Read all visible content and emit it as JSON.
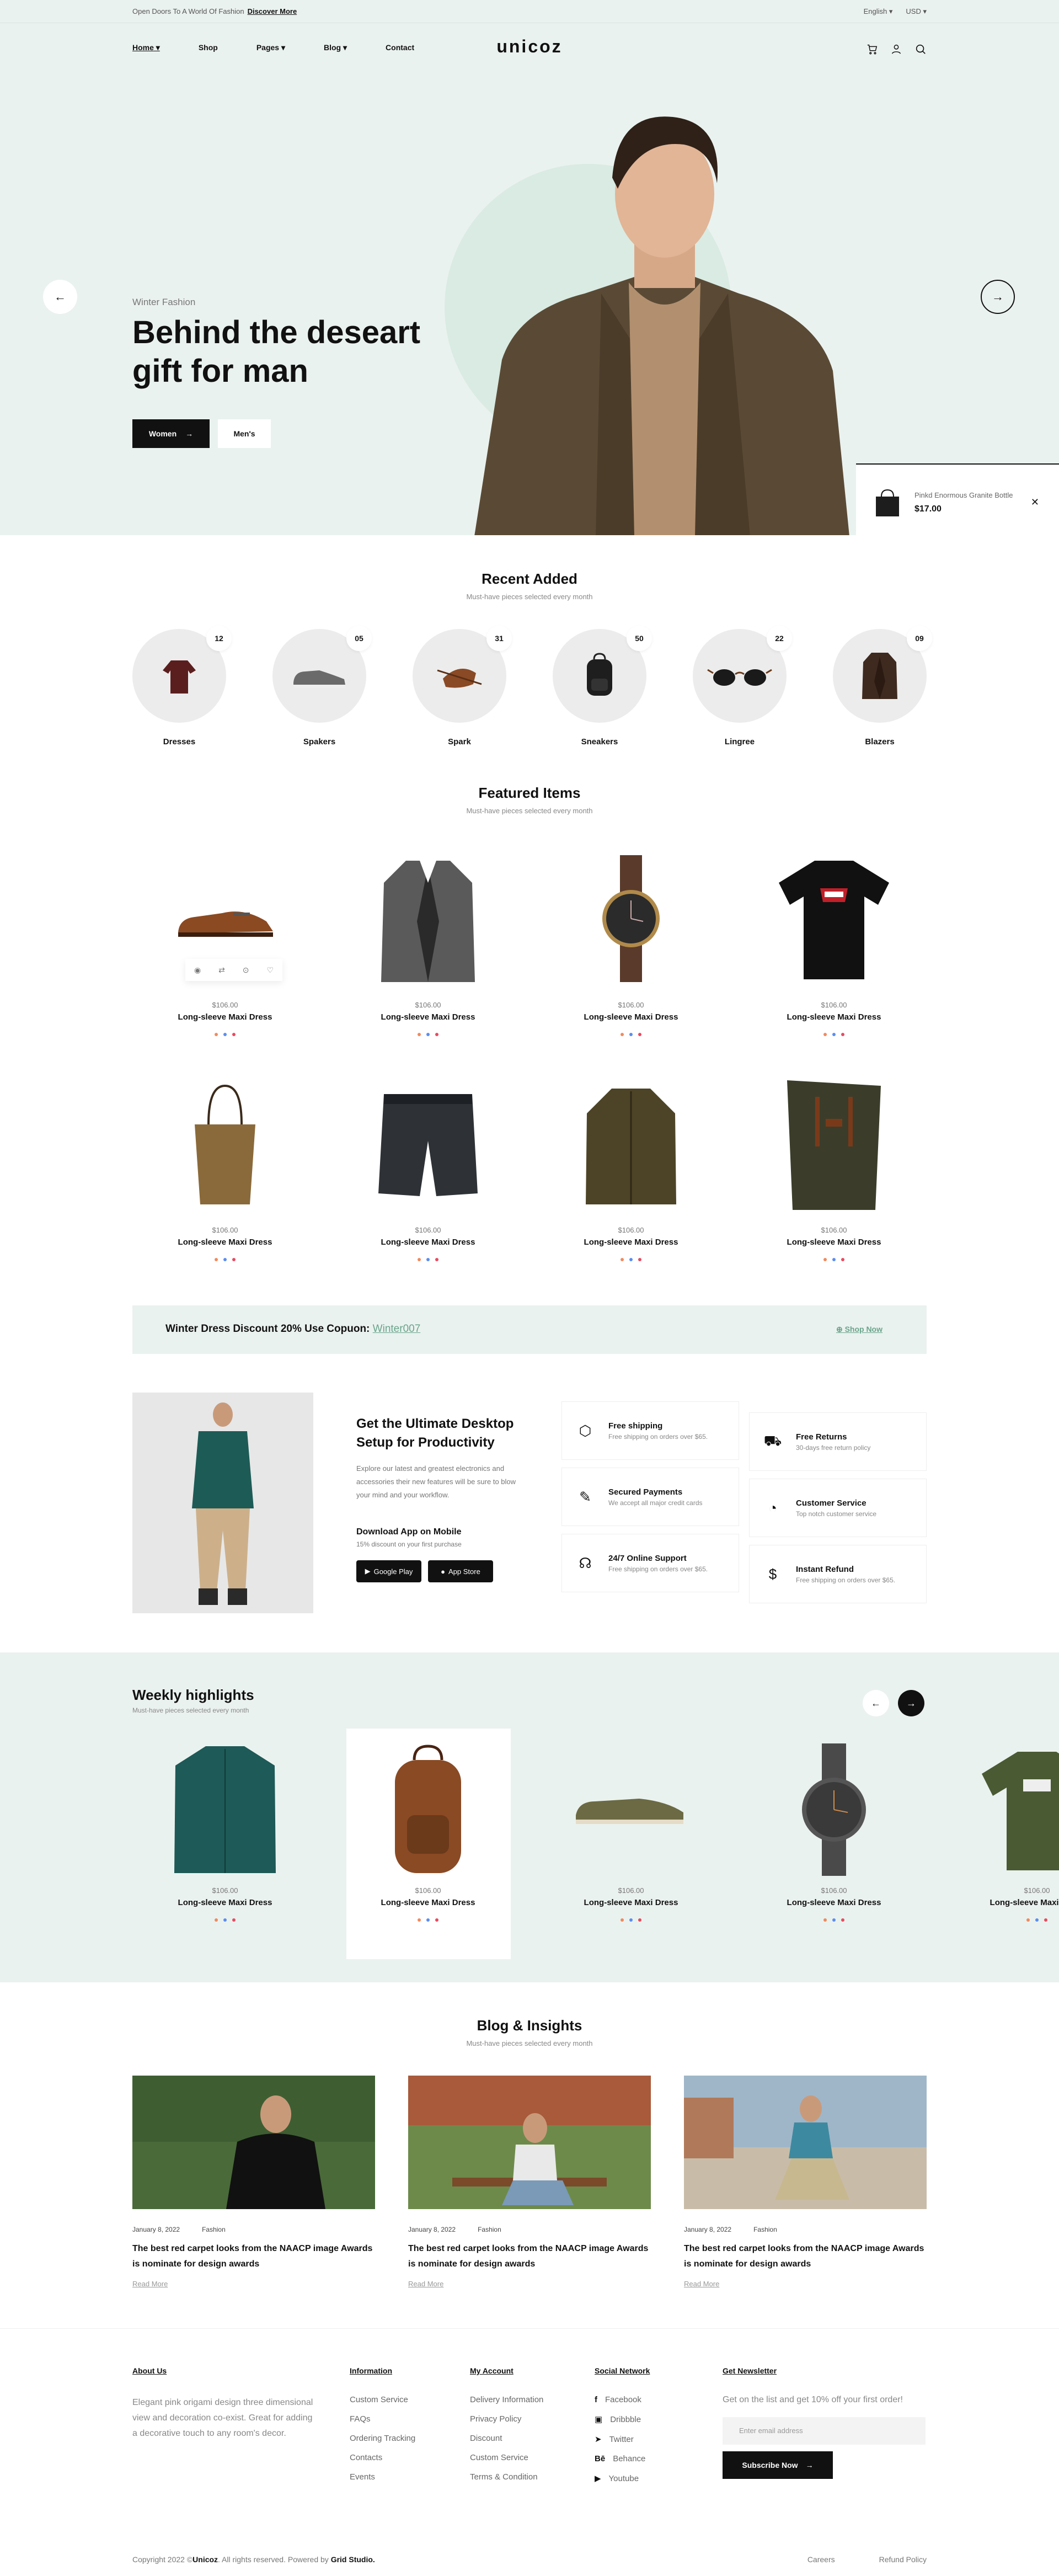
{
  "topbar": {
    "promo": "Open Doors To A World Of Fashion",
    "promo_link": "Discover More",
    "language": "English",
    "currency": "USD"
  },
  "nav": {
    "logo": "unicoz",
    "items": [
      {
        "label": "Home"
      },
      {
        "label": "Shop"
      },
      {
        "label": "Pages"
      },
      {
        "label": "Blog"
      },
      {
        "label": "Contact"
      }
    ]
  },
  "hero": {
    "subtitle": "Winter Fashion",
    "title": "Behind the deseart gift for man",
    "btn_primary": "Women",
    "btn_secondary": "Men's",
    "mini_product": {
      "title": "Pinkd Enormous Granite Bottle",
      "price": "$17.00"
    }
  },
  "recent": {
    "title": "Recent Added",
    "subtitle": "Must-have pieces selected every month",
    "categories": [
      {
        "label": "Dresses",
        "count": "12"
      },
      {
        "label": "Spakers",
        "count": "05"
      },
      {
        "label": "Spark",
        "count": "31"
      },
      {
        "label": "Sneakers",
        "count": "50"
      },
      {
        "label": "Lingree",
        "count": "22"
      },
      {
        "label": "Blazers",
        "count": "09"
      }
    ]
  },
  "featured": {
    "title": "Featured Items",
    "subtitle": "Must-have pieces selected every month",
    "products": [
      {
        "price": "$106.00",
        "name": "Long-sleeve Maxi Dress",
        "icon": "shoe-icon"
      },
      {
        "price": "$106.00",
        "name": "Long-sleeve Maxi Dress",
        "icon": "blazer-icon"
      },
      {
        "price": "$106.00",
        "name": "Long-sleeve Maxi Dress",
        "icon": "watch-icon"
      },
      {
        "price": "$106.00",
        "name": "Long-sleeve Maxi Dress",
        "icon": "tshirt-icon"
      },
      {
        "price": "$106.00",
        "name": "Long-sleeve Maxi Dress",
        "icon": "tote-bag-icon"
      },
      {
        "price": "$106.00",
        "name": "Long-sleeve Maxi Dress",
        "icon": "shorts-icon"
      },
      {
        "price": "$106.00",
        "name": "Long-sleeve Maxi Dress",
        "icon": "jacket-icon"
      },
      {
        "price": "$106.00",
        "name": "Long-sleeve Maxi Dress",
        "icon": "backpack-icon"
      }
    ]
  },
  "discount": {
    "text": "Winter Dress Discount 20% Use Copuon:",
    "code": "Winter007",
    "link": "Shop Now"
  },
  "promo": {
    "title": "Get the Ultimate Desktop Setup for Productivity",
    "body": "Explore our latest and greatest electronics and accessories their new features will be sure to blow your mind and your workflow.",
    "download_title": "Download App on Mobile",
    "download_sub": "15% discount on your first purchase",
    "google": "Google Play",
    "apple": "App Store"
  },
  "features": [
    {
      "title": "Free shipping",
      "sub": "Free shipping on orders over $65."
    },
    {
      "title": "Free Returns",
      "sub": "30-days free return policy"
    },
    {
      "title": "Secured Payments",
      "sub": "We accept all major credit cards"
    },
    {
      "title": "Customer Service",
      "sub": "Top notch customer service"
    },
    {
      "title": "24/7 Online Support",
      "sub": "Free shipping on orders over $65."
    },
    {
      "title": "Instant Refund",
      "sub": "Free shipping on orders over $65."
    }
  ],
  "weekly": {
    "title": "Weekly highlights",
    "subtitle": "Must-have pieces selected every month",
    "products": [
      {
        "price": "$106.00",
        "name": "Long-sleeve Maxi Dress"
      },
      {
        "price": "$106.00",
        "name": "Long-sleeve Maxi Dress"
      },
      {
        "price": "$106.00",
        "name": "Long-sleeve Maxi Dress"
      },
      {
        "price": "$106.00",
        "name": "Long-sleeve Maxi Dress"
      },
      {
        "price": "$106.00",
        "name": "Long-sleeve Maxi Dress"
      }
    ]
  },
  "blog": {
    "title": "Blog & Insights",
    "subtitle": "Must-have pieces selected every month",
    "posts": [
      {
        "date": "January 8, 2022",
        "cat": "Fashion",
        "title": "The best red carpet looks from the NAACP image Awards is nominate for design awards",
        "more": "Read More"
      },
      {
        "date": "January 8, 2022",
        "cat": "Fashion",
        "title": "The best red carpet looks from the NAACP image Awards is nominate for design awards",
        "more": "Read More"
      },
      {
        "date": "January 8, 2022",
        "cat": "Fashion",
        "title": "The best red carpet looks from the NAACP image Awards is nominate for design awards",
        "more": "Read More"
      }
    ]
  },
  "footer": {
    "about_title": "About Us",
    "about": "Elegant pink origami design three dimensional view and decoration co-exist. Great for adding a decorative touch to any room's decor.",
    "info_title": "Information",
    "info": [
      "Custom Service",
      "FAQs",
      "Ordering Tracking",
      "Contacts",
      "Events"
    ],
    "account_title": "My Account",
    "account": [
      "Delivery Information",
      "Privacy Policy",
      "Discount",
      "Custom Service",
      "Terms & Condition"
    ],
    "social_title": "Social Network",
    "social": [
      "Facebook",
      "Dribbble",
      "Twitter",
      "Behance",
      "Youtube"
    ],
    "news_title": "Get Newsletter",
    "news_text": "Get on the list and get 10% off your first order!",
    "news_placeholder": "Enter email address",
    "news_btn": "Subscribe Now",
    "copy_pre": "Copyright 2022 ©",
    "copy_brand": "Unicoz",
    "copy_mid": ". All rights reserved. Powered by",
    "copy_studio": "Grid Studio.",
    "links": [
      "Careers",
      "Refund Policy"
    ]
  },
  "colors": {
    "mint": "#eaf2ef",
    "accent": "#6aa48c",
    "dark": "#111111",
    "dot1": "#f08a5d",
    "dot2": "#5b8def",
    "dot3": "#e84a5f"
  }
}
